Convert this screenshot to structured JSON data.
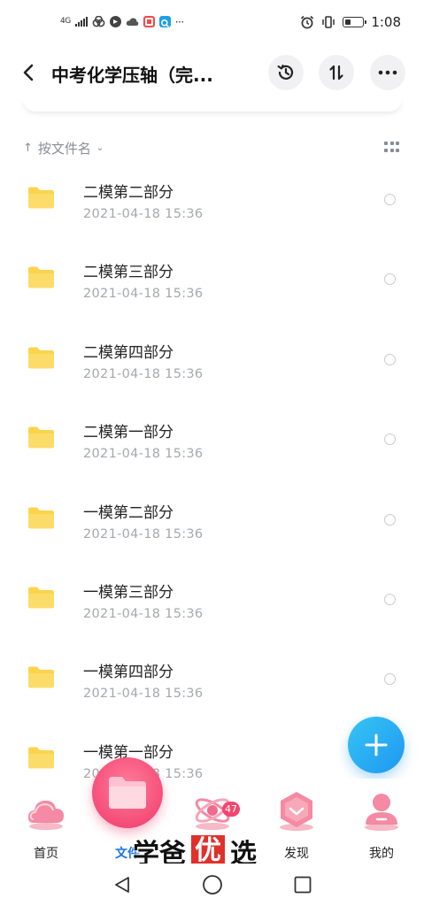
{
  "status_bar": {
    "network": "4G",
    "time": "1:08",
    "battery_level": 0.35,
    "app_icons": [
      "link-icon",
      "vpn-icon",
      "cloud-icon",
      "red-app-icon",
      "search-app-icon"
    ],
    "overflow": "···"
  },
  "header": {
    "title": "中考化学压轴（完..."
  },
  "sort": {
    "arrow": "↑",
    "label": "按文件名",
    "caret": "⌄"
  },
  "files": [
    {
      "name": "二模第二部分",
      "date": "2021-04-18  15:36"
    },
    {
      "name": "二模第三部分",
      "date": "2021-04-18  15:36"
    },
    {
      "name": "二模第四部分",
      "date": "2021-04-18  15:36"
    },
    {
      "name": "二模第一部分",
      "date": "2021-04-18  15:36"
    },
    {
      "name": "一模第二部分",
      "date": "2021-04-18  15:36"
    },
    {
      "name": "一模第三部分",
      "date": "2021-04-18  15:36"
    },
    {
      "name": "一模第四部分",
      "date": "2021-04-18  15:36"
    },
    {
      "name": "一模第一部分",
      "date": "2021-04-18  15:36"
    }
  ],
  "tabs": [
    {
      "label": "首页",
      "icon": "cloud-icon"
    },
    {
      "label": "文件",
      "icon": "folder-icon",
      "active": true
    },
    {
      "label": "共享",
      "icon": "atom-icon",
      "badge": "47"
    },
    {
      "label": "发现",
      "icon": "hexagon-icon"
    },
    {
      "label": "我的",
      "icon": "person-icon"
    }
  ],
  "watermark": {
    "before": "学爸",
    "boxed": "优",
    "after": "选"
  },
  "colors": {
    "folder": "#fcd34d",
    "fab": "#1f97f0",
    "active_tab": "#f1386a",
    "badge": "#f2456f"
  }
}
